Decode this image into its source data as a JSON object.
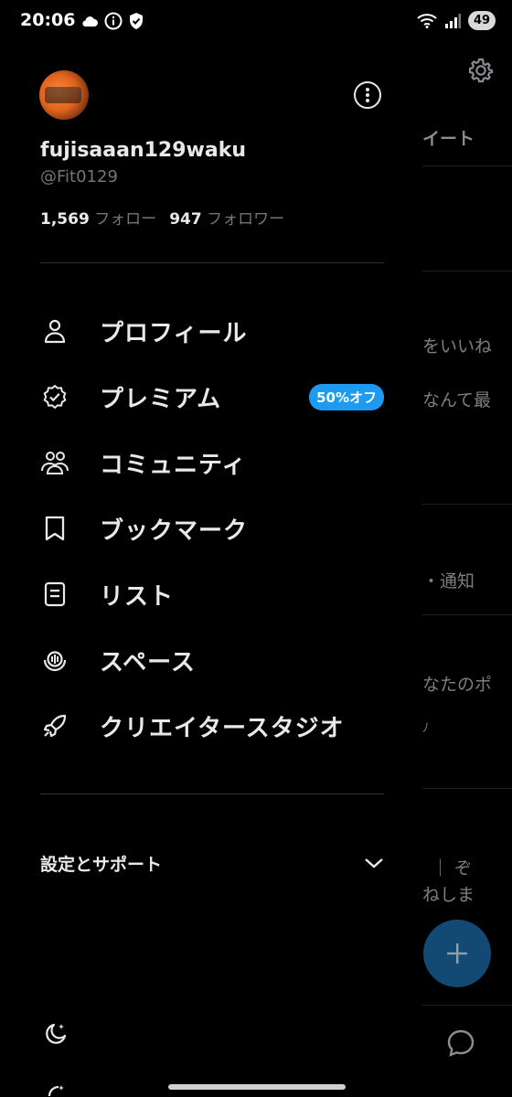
{
  "status_bar": {
    "time": "20:06",
    "battery": "49"
  },
  "profile": {
    "display_name": "fujisaaan129waku",
    "handle": "@Fit0129",
    "following_count": "1,569",
    "following_label": "フォロー",
    "followers_count": "947",
    "followers_label": "フォロワー"
  },
  "menu": {
    "items": [
      {
        "label": "プロフィール",
        "icon": "person-icon"
      },
      {
        "label": "プレミアム",
        "icon": "verified-badge-icon",
        "badge": "50%オフ"
      },
      {
        "label": "コミュニティ",
        "icon": "communities-icon"
      },
      {
        "label": "ブックマーク",
        "icon": "bookmark-icon"
      },
      {
        "label": "リスト",
        "icon": "list-icon"
      },
      {
        "label": "スペース",
        "icon": "spaces-icon"
      },
      {
        "label": "クリエイタースタジオ",
        "icon": "rocket-icon"
      }
    ]
  },
  "settings": {
    "label": "設定とサポート"
  },
  "timeline_fragments": [
    "イート",
    "をいいね",
    "なんて最",
    "・通知",
    "なたのポ",
    "ﾉ",
    "｜ ぞ",
    "ねしま"
  ],
  "colors": {
    "background": "#000000",
    "text": "#e7e9ea",
    "muted": "#71767b",
    "accent": "#1d9bf0",
    "divider": "#2f3336"
  }
}
